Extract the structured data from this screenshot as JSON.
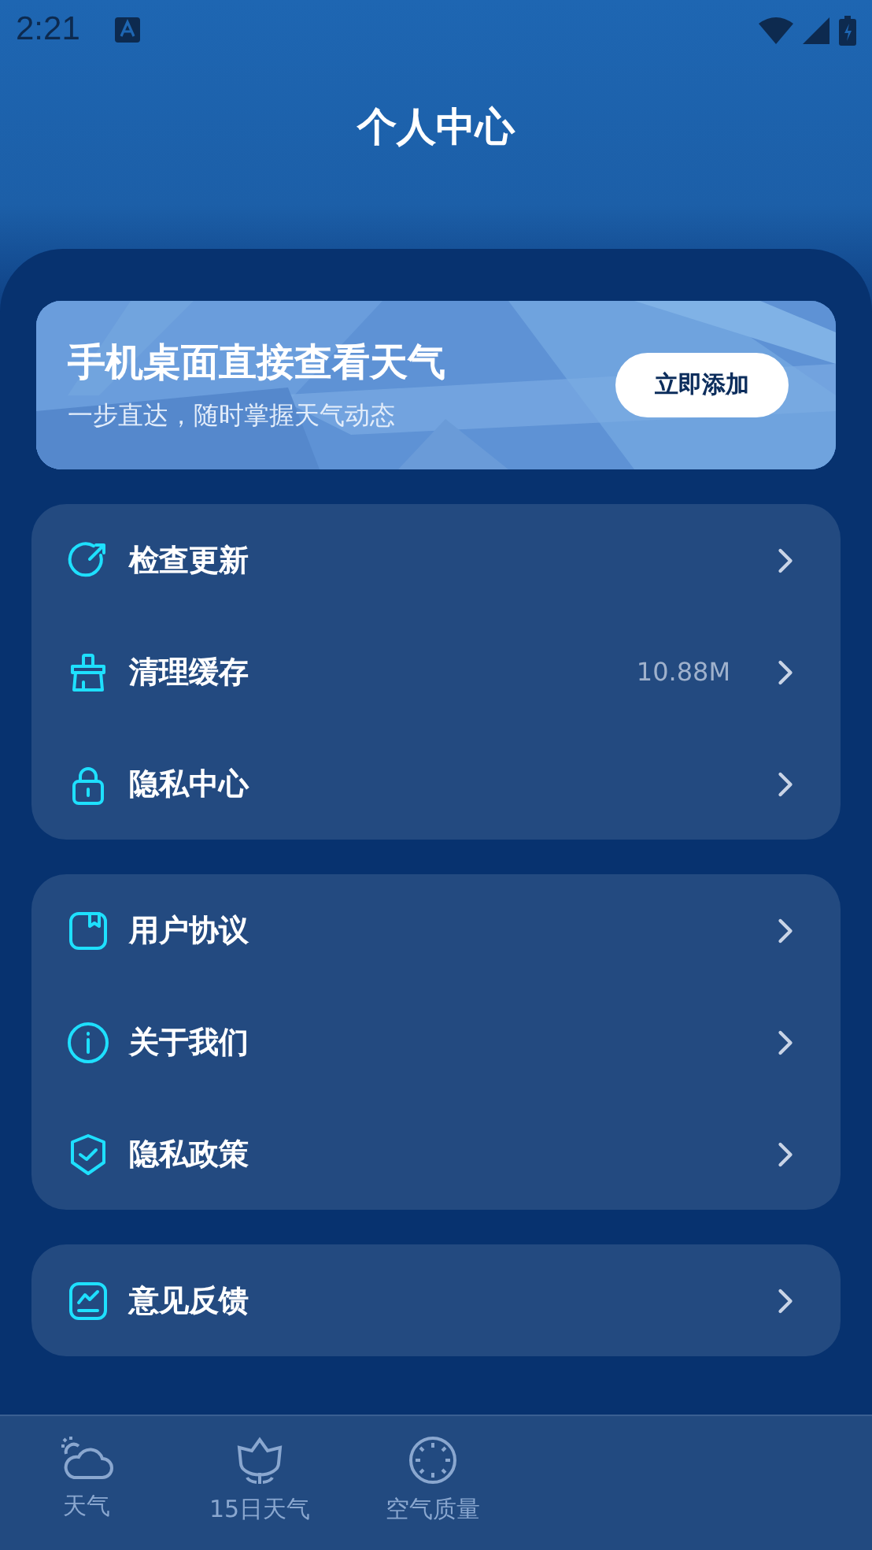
{
  "status_bar": {
    "time": "2:21"
  },
  "header": {
    "title": "个人中心"
  },
  "banner": {
    "title": "手机桌面直接查看天气",
    "subtitle": "一步直达，随时掌握天气动态",
    "button": "立即添加"
  },
  "groups": [
    {
      "items": [
        {
          "label": "检查更新"
        },
        {
          "label": "清理缓存",
          "value": "10.88M"
        },
        {
          "label": "隐私中心"
        }
      ]
    },
    {
      "items": [
        {
          "label": "用户协议"
        },
        {
          "label": "关于我们"
        },
        {
          "label": "隐私政策"
        }
      ]
    },
    {
      "items": [
        {
          "label": "意见反馈"
        }
      ]
    }
  ],
  "bottom_nav": [
    {
      "label": "天气",
      "selected": false
    },
    {
      "label": "15日天气",
      "selected": false
    },
    {
      "label": "空气质量",
      "selected": false
    }
  ]
}
